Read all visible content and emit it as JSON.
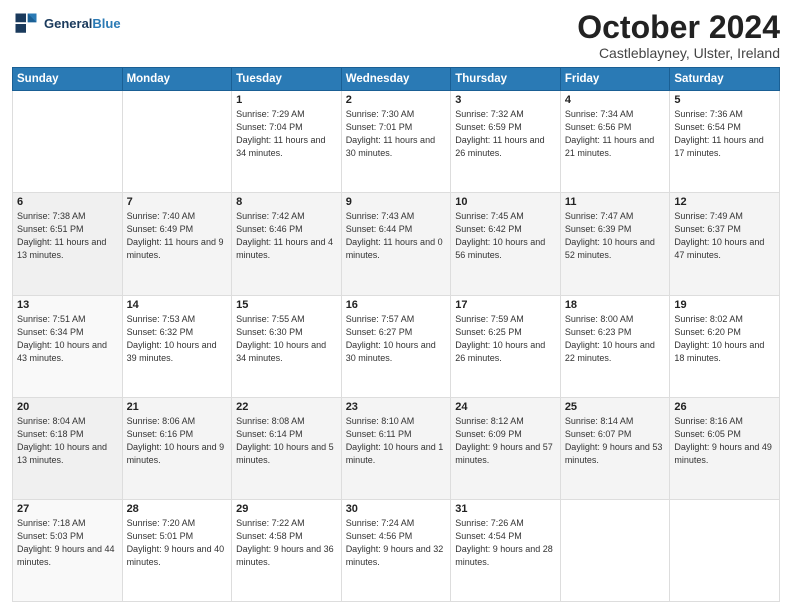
{
  "header": {
    "logo_line1": "General",
    "logo_line2": "Blue",
    "month": "October 2024",
    "location": "Castleblayney, Ulster, Ireland"
  },
  "weekdays": [
    "Sunday",
    "Monday",
    "Tuesday",
    "Wednesday",
    "Thursday",
    "Friday",
    "Saturday"
  ],
  "weeks": [
    [
      {
        "day": "",
        "sunrise": "",
        "sunset": "",
        "daylight": ""
      },
      {
        "day": "",
        "sunrise": "",
        "sunset": "",
        "daylight": ""
      },
      {
        "day": "1",
        "sunrise": "Sunrise: 7:29 AM",
        "sunset": "Sunset: 7:04 PM",
        "daylight": "Daylight: 11 hours and 34 minutes."
      },
      {
        "day": "2",
        "sunrise": "Sunrise: 7:30 AM",
        "sunset": "Sunset: 7:01 PM",
        "daylight": "Daylight: 11 hours and 30 minutes."
      },
      {
        "day": "3",
        "sunrise": "Sunrise: 7:32 AM",
        "sunset": "Sunset: 6:59 PM",
        "daylight": "Daylight: 11 hours and 26 minutes."
      },
      {
        "day": "4",
        "sunrise": "Sunrise: 7:34 AM",
        "sunset": "Sunset: 6:56 PM",
        "daylight": "Daylight: 11 hours and 21 minutes."
      },
      {
        "day": "5",
        "sunrise": "Sunrise: 7:36 AM",
        "sunset": "Sunset: 6:54 PM",
        "daylight": "Daylight: 11 hours and 17 minutes."
      }
    ],
    [
      {
        "day": "6",
        "sunrise": "Sunrise: 7:38 AM",
        "sunset": "Sunset: 6:51 PM",
        "daylight": "Daylight: 11 hours and 13 minutes."
      },
      {
        "day": "7",
        "sunrise": "Sunrise: 7:40 AM",
        "sunset": "Sunset: 6:49 PM",
        "daylight": "Daylight: 11 hours and 9 minutes."
      },
      {
        "day": "8",
        "sunrise": "Sunrise: 7:42 AM",
        "sunset": "Sunset: 6:46 PM",
        "daylight": "Daylight: 11 hours and 4 minutes."
      },
      {
        "day": "9",
        "sunrise": "Sunrise: 7:43 AM",
        "sunset": "Sunset: 6:44 PM",
        "daylight": "Daylight: 11 hours and 0 minutes."
      },
      {
        "day": "10",
        "sunrise": "Sunrise: 7:45 AM",
        "sunset": "Sunset: 6:42 PM",
        "daylight": "Daylight: 10 hours and 56 minutes."
      },
      {
        "day": "11",
        "sunrise": "Sunrise: 7:47 AM",
        "sunset": "Sunset: 6:39 PM",
        "daylight": "Daylight: 10 hours and 52 minutes."
      },
      {
        "day": "12",
        "sunrise": "Sunrise: 7:49 AM",
        "sunset": "Sunset: 6:37 PM",
        "daylight": "Daylight: 10 hours and 47 minutes."
      }
    ],
    [
      {
        "day": "13",
        "sunrise": "Sunrise: 7:51 AM",
        "sunset": "Sunset: 6:34 PM",
        "daylight": "Daylight: 10 hours and 43 minutes."
      },
      {
        "day": "14",
        "sunrise": "Sunrise: 7:53 AM",
        "sunset": "Sunset: 6:32 PM",
        "daylight": "Daylight: 10 hours and 39 minutes."
      },
      {
        "day": "15",
        "sunrise": "Sunrise: 7:55 AM",
        "sunset": "Sunset: 6:30 PM",
        "daylight": "Daylight: 10 hours and 34 minutes."
      },
      {
        "day": "16",
        "sunrise": "Sunrise: 7:57 AM",
        "sunset": "Sunset: 6:27 PM",
        "daylight": "Daylight: 10 hours and 30 minutes."
      },
      {
        "day": "17",
        "sunrise": "Sunrise: 7:59 AM",
        "sunset": "Sunset: 6:25 PM",
        "daylight": "Daylight: 10 hours and 26 minutes."
      },
      {
        "day": "18",
        "sunrise": "Sunrise: 8:00 AM",
        "sunset": "Sunset: 6:23 PM",
        "daylight": "Daylight: 10 hours and 22 minutes."
      },
      {
        "day": "19",
        "sunrise": "Sunrise: 8:02 AM",
        "sunset": "Sunset: 6:20 PM",
        "daylight": "Daylight: 10 hours and 18 minutes."
      }
    ],
    [
      {
        "day": "20",
        "sunrise": "Sunrise: 8:04 AM",
        "sunset": "Sunset: 6:18 PM",
        "daylight": "Daylight: 10 hours and 13 minutes."
      },
      {
        "day": "21",
        "sunrise": "Sunrise: 8:06 AM",
        "sunset": "Sunset: 6:16 PM",
        "daylight": "Daylight: 10 hours and 9 minutes."
      },
      {
        "day": "22",
        "sunrise": "Sunrise: 8:08 AM",
        "sunset": "Sunset: 6:14 PM",
        "daylight": "Daylight: 10 hours and 5 minutes."
      },
      {
        "day": "23",
        "sunrise": "Sunrise: 8:10 AM",
        "sunset": "Sunset: 6:11 PM",
        "daylight": "Daylight: 10 hours and 1 minute."
      },
      {
        "day": "24",
        "sunrise": "Sunrise: 8:12 AM",
        "sunset": "Sunset: 6:09 PM",
        "daylight": "Daylight: 9 hours and 57 minutes."
      },
      {
        "day": "25",
        "sunrise": "Sunrise: 8:14 AM",
        "sunset": "Sunset: 6:07 PM",
        "daylight": "Daylight: 9 hours and 53 minutes."
      },
      {
        "day": "26",
        "sunrise": "Sunrise: 8:16 AM",
        "sunset": "Sunset: 6:05 PM",
        "daylight": "Daylight: 9 hours and 49 minutes."
      }
    ],
    [
      {
        "day": "27",
        "sunrise": "Sunrise: 7:18 AM",
        "sunset": "Sunset: 5:03 PM",
        "daylight": "Daylight: 9 hours and 44 minutes."
      },
      {
        "day": "28",
        "sunrise": "Sunrise: 7:20 AM",
        "sunset": "Sunset: 5:01 PM",
        "daylight": "Daylight: 9 hours and 40 minutes."
      },
      {
        "day": "29",
        "sunrise": "Sunrise: 7:22 AM",
        "sunset": "Sunset: 4:58 PM",
        "daylight": "Daylight: 9 hours and 36 minutes."
      },
      {
        "day": "30",
        "sunrise": "Sunrise: 7:24 AM",
        "sunset": "Sunset: 4:56 PM",
        "daylight": "Daylight: 9 hours and 32 minutes."
      },
      {
        "day": "31",
        "sunrise": "Sunrise: 7:26 AM",
        "sunset": "Sunset: 4:54 PM",
        "daylight": "Daylight: 9 hours and 28 minutes."
      },
      {
        "day": "",
        "sunrise": "",
        "sunset": "",
        "daylight": ""
      },
      {
        "day": "",
        "sunrise": "",
        "sunset": "",
        "daylight": ""
      }
    ]
  ]
}
